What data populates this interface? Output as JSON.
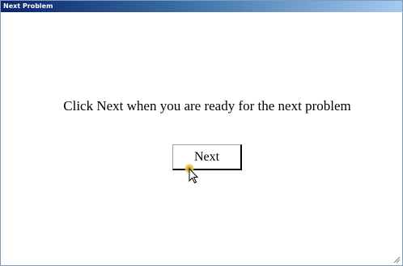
{
  "window": {
    "title": "Next Problem",
    "titlebar_gradient": [
      "#0a246a",
      "#3a6ea5",
      "#a6caf0"
    ]
  },
  "main": {
    "message": "Click Next when you are ready for the next problem",
    "next_button_label": "Next"
  },
  "icons": {
    "cursor": "mouse-pointer-arrow",
    "grip": "resize-grip"
  }
}
